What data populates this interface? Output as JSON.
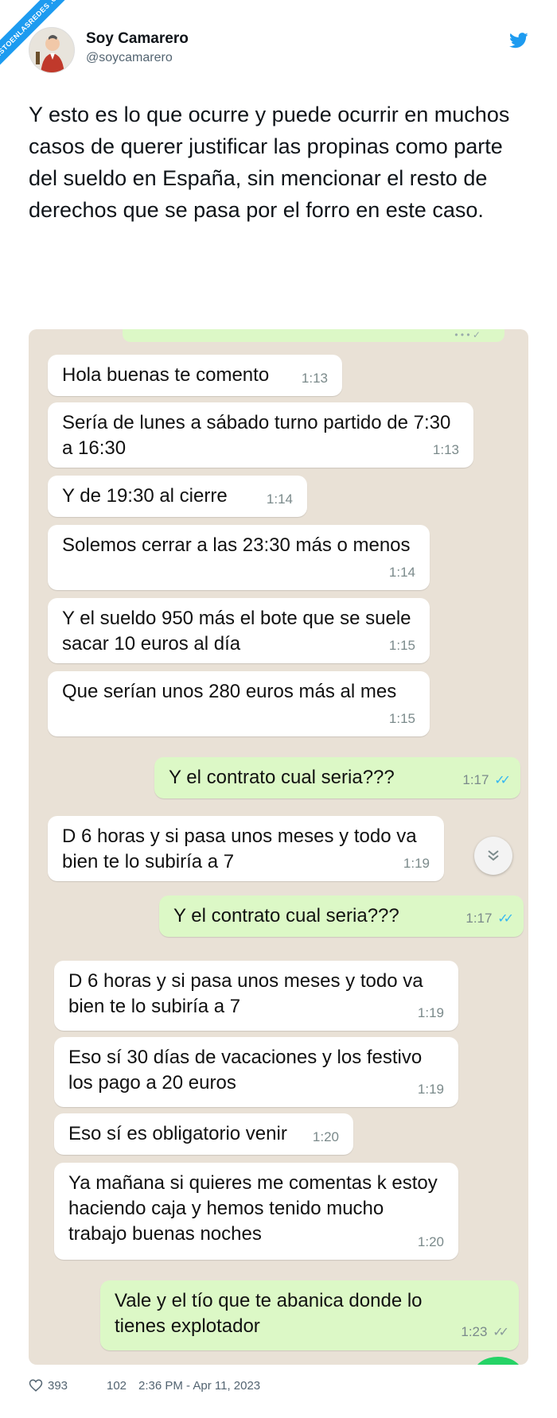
{
  "watermark": {
    "text": "VISTOENLASREDES .COM"
  },
  "author": {
    "name": "Soy Camarero",
    "handle": "@soycamarero"
  },
  "tweet": {
    "text": "Y esto es lo que ocurre y puede ocurrir en muchos casos de querer justificar las propinas como parte del sueldo en España, sin mencionar el resto de derechos que se pasa por el forro en este caso."
  },
  "chat": {
    "messages": [
      {
        "text": "Hola buenas te comento",
        "time": "1:13",
        "direction": "in"
      },
      {
        "text": "Sería de lunes a sábado turno partido de 7:30 a 16:30",
        "time": "1:13",
        "direction": "in"
      },
      {
        "text": "Y de 19:30 al cierre",
        "time": "1:14",
        "direction": "in"
      },
      {
        "text": "Solemos cerrar a las 23:30 más o menos",
        "time": "1:14",
        "direction": "in"
      },
      {
        "text": "Y el sueldo 950 más el bote que se suele sacar 10 euros al día",
        "time": "1:15",
        "direction": "in"
      },
      {
        "text": "Que serían unos 280 euros más al mes",
        "time": "1:15",
        "direction": "in"
      },
      {
        "text": "Y el contrato cual seria???",
        "time": "1:17",
        "direction": "out",
        "read": true
      },
      {
        "text": "D 6 horas y si pasa unos meses y todo va bien te lo subiría a 7",
        "time": "1:19",
        "direction": "in"
      },
      {
        "text": "Y el contrato cual seria???",
        "time": "1:17",
        "direction": "out",
        "read": true
      },
      {
        "text": "D 6 horas y si pasa unos meses y todo va bien te lo subiría a 7",
        "time": "1:19",
        "direction": "in"
      },
      {
        "text": "Eso sí 30 días de vacaciones y los festivo los pago a 20 euros",
        "time": "1:19",
        "direction": "in"
      },
      {
        "text": "Eso sí es obligatorio venir",
        "time": "1:20",
        "direction": "in"
      },
      {
        "text": "Ya mañana si quieres me comentas k estoy haciendo caja y hemos tenido mucho trabajo buenas noches",
        "time": "1:20",
        "direction": "in"
      },
      {
        "text": "Vale y el tío que te abanica donde lo tienes explotador",
        "time": "1:23",
        "direction": "out",
        "read": false
      }
    ]
  },
  "footer": {
    "likes": "393",
    "replies": "102",
    "timestamp": "2:36 PM - Apr 11, 2023"
  },
  "colors": {
    "twitter_blue": "#1d9bf0",
    "chat_bg": "#e9e1d6",
    "bubble_out": "#dcf8c6",
    "read_ticks": "#34b7f1"
  },
  "icons": [
    "twitter-bird-icon",
    "heart-icon",
    "chevron-down-icon",
    "double-check-icon"
  ]
}
